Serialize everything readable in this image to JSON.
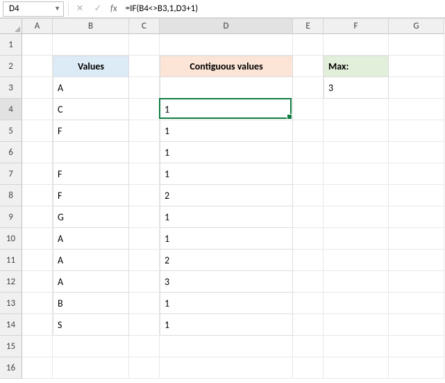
{
  "name_box": "D4",
  "formula": "=IF(B4<>B3,1,D3+1)",
  "columns": [
    "A",
    "B",
    "C",
    "D",
    "E",
    "F",
    "G"
  ],
  "rows": [
    "1",
    "2",
    "3",
    "4",
    "5",
    "6",
    "7",
    "8",
    "9",
    "10",
    "11",
    "12",
    "13",
    "14",
    "15",
    "16"
  ],
  "headers": {
    "b2": "Values",
    "d2": "Contiguous values",
    "f2": "Max:"
  },
  "colB": {
    "r3": "A",
    "r4": "C",
    "r5": "F",
    "r6": "",
    "r7": "F",
    "r8": "F",
    "r9": "G",
    "r10": "A",
    "r11": "A",
    "r12": "A",
    "r13": "B",
    "r14": "S"
  },
  "colD": {
    "r3": "",
    "r4": "1",
    "r5": "1",
    "r6": "1",
    "r7": "1",
    "r8": "2",
    "r9": "1",
    "r10": "1",
    "r11": "2",
    "r12": "3",
    "r13": "1",
    "r14": "1"
  },
  "colF": {
    "r3": "3"
  },
  "chart_data": {
    "type": "table",
    "columns": [
      "Values",
      "Contiguous values"
    ],
    "rows": [
      [
        "A",
        ""
      ],
      [
        "C",
        1
      ],
      [
        "F",
        1
      ],
      [
        "",
        1
      ],
      [
        "F",
        1
      ],
      [
        "F",
        2
      ],
      [
        "G",
        1
      ],
      [
        "A",
        1
      ],
      [
        "A",
        2
      ],
      [
        "A",
        3
      ],
      [
        "B",
        1
      ],
      [
        "S",
        1
      ]
    ],
    "max_label": "Max:",
    "max_value": 3,
    "active_cell": "D4",
    "formula": "=IF(B4<>B3,1,D3+1)"
  }
}
